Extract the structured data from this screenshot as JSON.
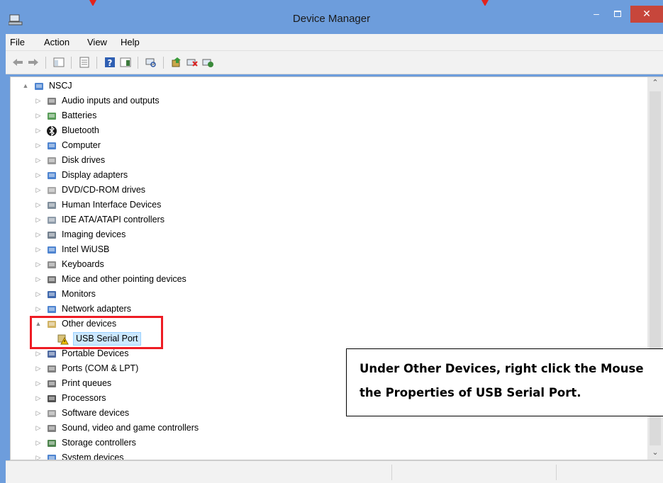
{
  "window": {
    "title": "Device Manager"
  },
  "menu": [
    "File",
    "Action",
    "View",
    "Help"
  ],
  "tree": {
    "root": "NSCJ",
    "items": [
      {
        "label": "Audio inputs and outputs",
        "icon": "speaker-icon"
      },
      {
        "label": "Batteries",
        "icon": "battery-icon"
      },
      {
        "label": "Bluetooth",
        "icon": "bluetooth-icon"
      },
      {
        "label": "Computer",
        "icon": "computer-icon"
      },
      {
        "label": "Disk drives",
        "icon": "disk-drive-icon"
      },
      {
        "label": "Display adapters",
        "icon": "display-adapter-icon"
      },
      {
        "label": "DVD/CD-ROM drives",
        "icon": "dvd-drive-icon"
      },
      {
        "label": "Human Interface Devices",
        "icon": "hid-icon"
      },
      {
        "label": "IDE ATA/ATAPI controllers",
        "icon": "ide-controller-icon"
      },
      {
        "label": "Imaging devices",
        "icon": "camera-icon"
      },
      {
        "label": "Intel WiUSB",
        "icon": "network-icon"
      },
      {
        "label": "Keyboards",
        "icon": "keyboard-icon"
      },
      {
        "label": "Mice and other pointing devices",
        "icon": "mouse-icon"
      },
      {
        "label": "Monitors",
        "icon": "monitor-icon"
      },
      {
        "label": "Network adapters",
        "icon": "network-adapter-icon"
      },
      {
        "label": "Other devices",
        "icon": "unknown-device-icon",
        "expanded": true,
        "children": [
          {
            "label": "USB Serial Port",
            "icon": "warning-device-icon",
            "selected": true
          }
        ]
      },
      {
        "label": "Portable Devices",
        "icon": "portable-device-icon"
      },
      {
        "label": "Ports (COM & LPT)",
        "icon": "port-icon"
      },
      {
        "label": "Print queues",
        "icon": "printer-icon"
      },
      {
        "label": "Processors",
        "icon": "processor-icon"
      },
      {
        "label": "Software devices",
        "icon": "software-device-icon"
      },
      {
        "label": "Sound, video and game controllers",
        "icon": "sound-icon"
      },
      {
        "label": "Storage controllers",
        "icon": "storage-icon"
      },
      {
        "label": "System devices",
        "icon": "system-device-icon"
      }
    ]
  },
  "annotation": {
    "line1": "Under Other Devices, right click the Mouse",
    "line2": "the Properties of USB Serial Port."
  },
  "colors": {
    "titlebar": "#6d9ddc",
    "close": "#c7463b",
    "highlight": "#ee1c24",
    "selection": "#cce8ff"
  }
}
